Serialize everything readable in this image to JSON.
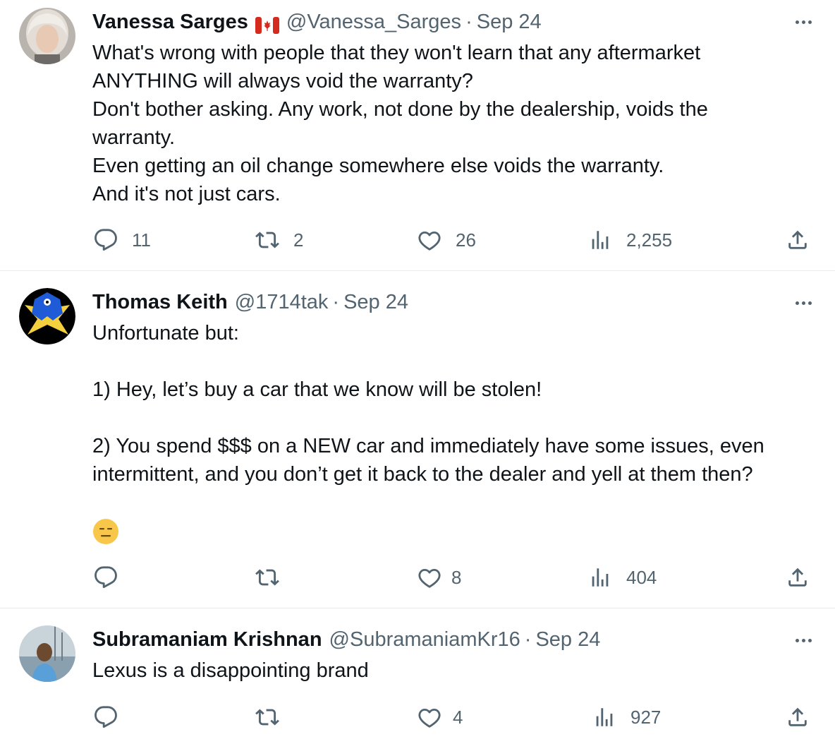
{
  "tweets": [
    {
      "name": "Vanessa Sarges",
      "flag": "canada-flag",
      "handle": "@Vanessa_Sarges",
      "separator": "·",
      "date": "Sep 24",
      "text": "What's wrong with people that they won't learn that any aftermarket\nANYTHING will always void the warranty?\nDon't bother asking. Any work, not done by the dealership, voids the\nwarranty.\nEven getting an oil change somewhere else voids the warranty.\nAnd it's not just cars.",
      "replies": "11",
      "retweets": "2",
      "likes": "26",
      "views": "2,255"
    },
    {
      "name": "Thomas Keith",
      "handle": "@1714tak",
      "separator": "·",
      "date": "Sep 24",
      "text": "Unfortunate but:\n\n1) Hey, let’s buy a car that we know will be stolen!\n\n2) You spend $$$ on a NEW car and immediately have some issues, even\nintermittent, and you don’t get it back to the dealer and yell at them then?",
      "emoji": "expressionless-face-emoji",
      "replies": "",
      "retweets": "",
      "likes": "8",
      "views": "404"
    },
    {
      "name": "Subramaniam Krishnan",
      "handle": "@SubramaniamKr16",
      "separator": "·",
      "date": "Sep 24",
      "text": "Lexus is a disappointing brand",
      "replies": "",
      "retweets": "",
      "likes": "4",
      "views": "927"
    }
  ],
  "icons": {
    "reply": "reply-icon",
    "retweet": "retweet-icon",
    "like": "heart-icon",
    "views": "views-icon",
    "share": "share-icon",
    "more": "more-icon"
  },
  "colors": {
    "text": "#0f1419",
    "secondary": "#536471",
    "divider": "#e6ecf0"
  }
}
